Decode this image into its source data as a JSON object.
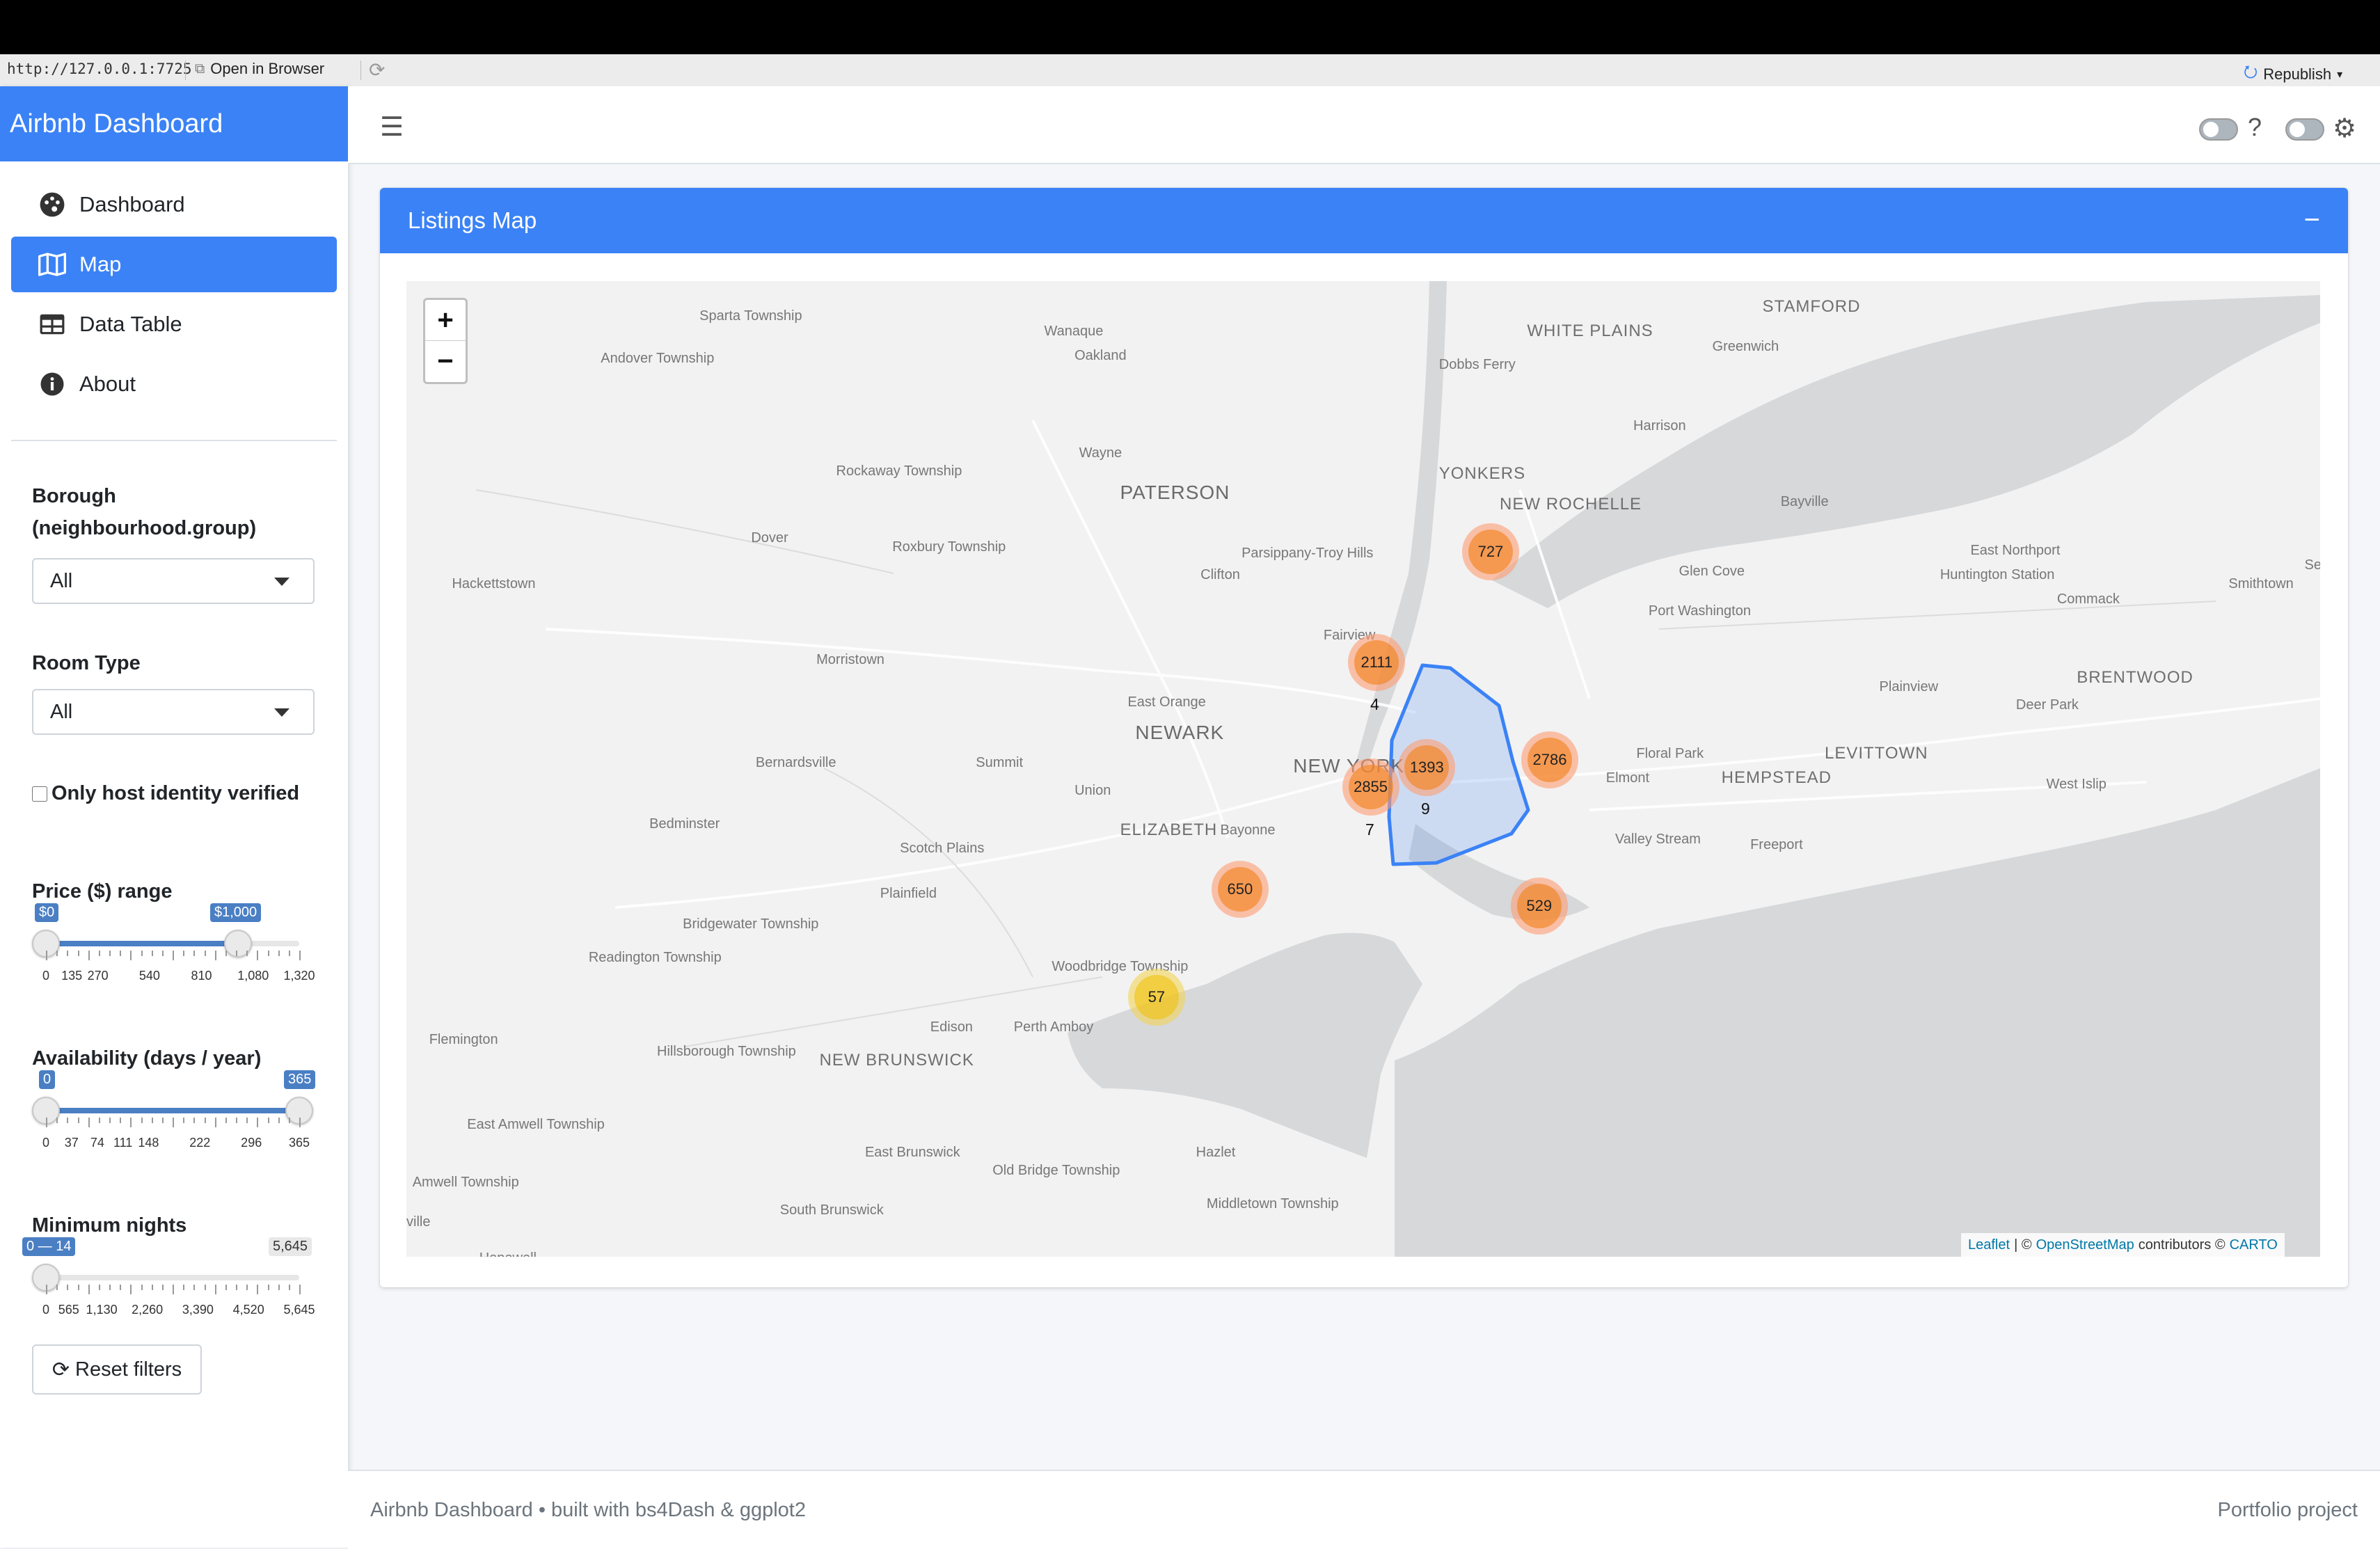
{
  "browser": {
    "url": "http://127.0.0.1:7725",
    "open_in_browser": "Open in Browser",
    "republish": "Republish"
  },
  "sidebar": {
    "brand": "Airbnb Dashboard",
    "nav": [
      {
        "label": "Dashboard",
        "icon": "palette-icon"
      },
      {
        "label": "Map",
        "icon": "map-icon",
        "active": true
      },
      {
        "label": "Data Table",
        "icon": "table-icon"
      },
      {
        "label": "About",
        "icon": "info-icon"
      }
    ],
    "filters": {
      "borough_label_1": "Borough",
      "borough_label_2": "(neighbourhood.group)",
      "borough_value": "All",
      "room_type_label": "Room Type",
      "room_type_value": "All",
      "host_verified_label": "Only host identity verified",
      "host_verified_checked": false,
      "price": {
        "label": "Price ($) range",
        "min_tip": "$0",
        "max_tip": "$1,000",
        "ticks": [
          "0",
          "135",
          "270",
          "540",
          "810",
          "1,080",
          "1,320"
        ],
        "range": [
          0,
          1000
        ],
        "limits": [
          0,
          1320
        ]
      },
      "availability": {
        "label": "Availability (days / year)",
        "min_tip": "0",
        "max_tip": "365",
        "ticks": [
          "0",
          "37",
          "74",
          "111",
          "148",
          "222",
          "296",
          "365"
        ],
        "range": [
          0,
          365
        ],
        "limits": [
          0,
          365
        ]
      },
      "min_nights": {
        "label": "Minimum nights",
        "range_tip": "0 — 14",
        "max_tip": "5,645",
        "ticks": [
          "0",
          "565",
          "1,130",
          "2,260",
          "3,390",
          "4,520",
          "5,645"
        ],
        "range": [
          0,
          14
        ],
        "limits": [
          0,
          5645
        ]
      },
      "reset_label": "Reset filters"
    }
  },
  "card": {
    "title": "Listings Map",
    "collapse": "−"
  },
  "map": {
    "zoom_in": "+",
    "zoom_out": "−",
    "clusters": [
      {
        "count": "727",
        "color": "orange"
      },
      {
        "count": "2111",
        "color": "orange"
      },
      {
        "count": "1393",
        "color": "orange"
      },
      {
        "count": "2786",
        "color": "orange"
      },
      {
        "count": "2855",
        "color": "orange"
      },
      {
        "count": "650",
        "color": "orange"
      },
      {
        "count": "529",
        "color": "orange"
      },
      {
        "count": "57",
        "color": "yellow"
      }
    ],
    "cluster_children": [
      "4",
      "9",
      "7"
    ],
    "places": [
      "Sparta Township",
      "Wanaque",
      "Oakland",
      "Andover Township",
      "WHITE PLAINS",
      "STAMFORD",
      "Greenwich",
      "Dobbs Ferry",
      "Harrison",
      "Wayne",
      "Rockaway Township",
      "PATERSON",
      "YONKERS",
      "NEW ROCHELLE",
      "Bayville",
      "Dover",
      "Roxbury Township",
      "Parsippany-Troy Hills",
      "Clifton",
      "Hackettstown",
      "Glen Cove",
      "East Northport",
      "Huntington Station",
      "Commack",
      "Smithtown",
      "Port Washington",
      "Fairview",
      "Morristown",
      "East Orange",
      "Plainview",
      "BRENTWOOD",
      "Deer Park",
      "NEWARK",
      "Bernardsville",
      "Summit",
      "NEW YORK",
      "Floral Park",
      "LEVITTOWN",
      "Elmont",
      "HEMPSTEAD",
      "West Islip",
      "Union",
      "Bedminster",
      "ELIZABETH",
      "Bayonne",
      "Valley Stream",
      "Freeport",
      "Scotch Plains",
      "Plainfield",
      "Bridgewater Township",
      "Readington Township",
      "Woodbridge Township",
      "Edison",
      "Perth Amboy",
      "Flemington",
      "Hillsborough Township",
      "NEW BRUNSWICK",
      "East Amwell Township",
      "East Brunswick",
      "Old Bridge Township",
      "Hazlet",
      "Amwell Township",
      "ville",
      "South Brunswick",
      "Middletown Township",
      "Hopewell",
      "Selo"
    ],
    "attribution_leaflet": "Leaflet",
    "attribution_sep": "| ©",
    "attribution_osm": "OpenStreetMap",
    "attribution_mid": "contributors ©",
    "attribution_carto": "CARTO"
  },
  "footer": {
    "left": "Airbnb Dashboard • built with bs4Dash & ggplot2",
    "right": "Portfolio project"
  },
  "colors": {
    "primary": "#3b82f6",
    "slider": "#4a7fc4",
    "cluster_orange": "#f0a070",
    "cluster_yellow": "#f1d357"
  }
}
